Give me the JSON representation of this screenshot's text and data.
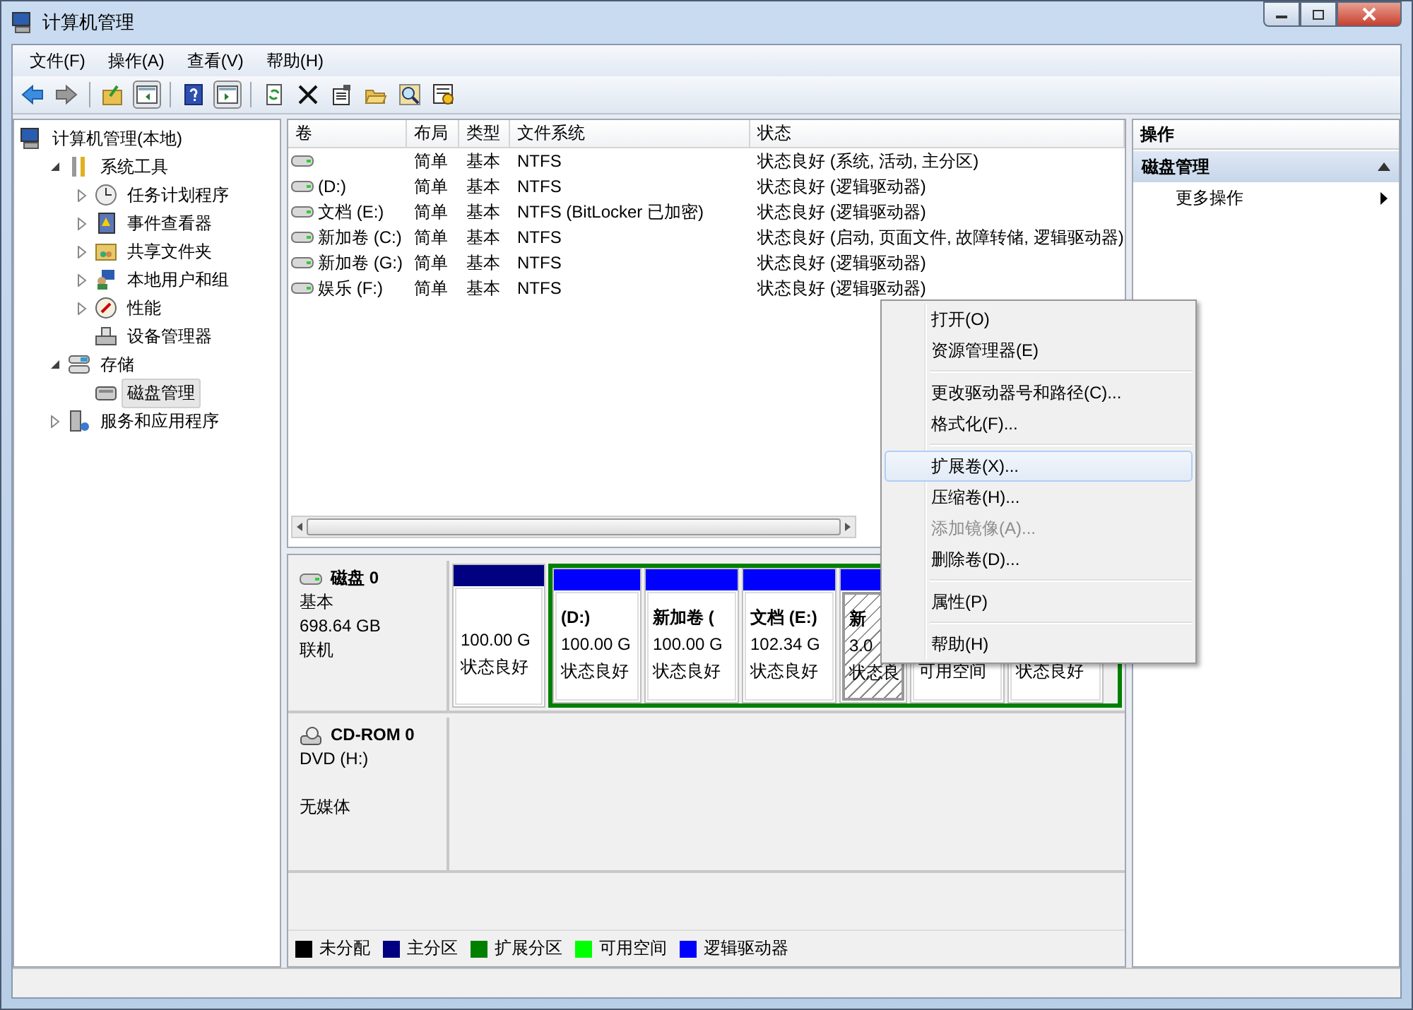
{
  "window": {
    "title": "计算机管理"
  },
  "menu_bar": [
    "文件(F)",
    "操作(A)",
    "查看(V)",
    "帮助(H)"
  ],
  "tree": [
    {
      "label": "计算机管理(本地)",
      "selected": false,
      "children": [
        {
          "label": "系统工具",
          "selected": false,
          "expanded": true,
          "children": [
            {
              "label": "任务计划程序",
              "selected": false,
              "expanded": false
            },
            {
              "label": "事件查看器",
              "selected": false,
              "expanded": false
            },
            {
              "label": "共享文件夹",
              "selected": false,
              "expanded": false
            },
            {
              "label": "本地用户和组",
              "selected": false,
              "expanded": false
            },
            {
              "label": "性能",
              "selected": false,
              "expanded": false
            },
            {
              "label": "设备管理器",
              "selected": false
            }
          ]
        },
        {
          "label": "存储",
          "selected": false,
          "expanded": true,
          "children": [
            {
              "label": "磁盘管理",
              "selected": true
            }
          ]
        },
        {
          "label": "服务和应用程序",
          "selected": false,
          "expanded": false
        }
      ]
    }
  ],
  "volume_table": {
    "columns": [
      "卷",
      "布局",
      "类型",
      "文件系统",
      "状态"
    ],
    "rows": [
      {
        "layout": "简单",
        "type": "基本",
        "file_system": "NTFS",
        "status": "状态良好 (系统, 活动, 主分区)"
      },
      {
        "volume": "(D:)",
        "layout": "简单",
        "type": "基本",
        "file_system": "NTFS",
        "status": "状态良好 (逻辑驱动器)"
      },
      {
        "volume": "文档 (E:)",
        "layout": "简单",
        "type": "基本",
        "file_system": "NTFS (BitLocker 已加密)",
        "status": "状态良好 (逻辑驱动器)"
      },
      {
        "volume": "新加卷 (C:)",
        "layout": "简单",
        "type": "基本",
        "file_system": "NTFS",
        "status": "状态良好 (启动, 页面文件, 故障转储, 逻辑驱动器)"
      },
      {
        "volume": "新加卷 (G:)",
        "layout": "简单",
        "type": "基本",
        "file_system": "NTFS",
        "status": "状态良好 (逻辑驱动器)"
      },
      {
        "volume": "娱乐 (F:)",
        "layout": "简单",
        "type": "基本",
        "file_system": "NTFS",
        "status": "状态良好 (逻辑驱动器)"
      }
    ]
  },
  "disks": [
    {
      "name": "磁盘 0",
      "kind": "disk",
      "lines": [
        "基本",
        "698.64 GB"
      ],
      "status": "联机",
      "partitions": [
        {
          "kind": "primary",
          "selected": false,
          "size": "100.00 G",
          "status": "状态良好"
        },
        {
          "kind": "extended",
          "children": [
            {
              "kind": "logical",
              "selected": false,
              "label": "(D:)",
              "size": "100.00 G",
              "status": "状态良好"
            },
            {
              "kind": "logical",
              "selected": false,
              "label": "新加卷 (",
              "size": "100.00 G",
              "status": "状态良好"
            },
            {
              "kind": "logical",
              "selected": false,
              "label": "文档 (E:)",
              "size": "102.34 G",
              "status": "状态良好"
            },
            {
              "kind": "logical",
              "selected": true,
              "label": "新",
              "size": "3.0",
              "status": "状态良"
            },
            {
              "kind": "free",
              "selected": false,
              "status": "可用空间"
            },
            {
              "kind": "logical",
              "selected": false,
              "status": "状态良好"
            }
          ]
        }
      ]
    },
    {
      "name": "CD-ROM 0",
      "kind": "cdrom",
      "lines": [
        "DVD (H:)"
      ],
      "status": "无媒体"
    }
  ],
  "legend": [
    {
      "label": "未分配",
      "color": "#000000"
    },
    {
      "label": "主分区",
      "color": "#000080"
    },
    {
      "label": "扩展分区",
      "color": "#008000"
    },
    {
      "label": "可用空间",
      "color": "#00ff00"
    },
    {
      "label": "逻辑驱动器",
      "color": "#0000ff"
    }
  ],
  "actions": {
    "title": "操作",
    "section": "磁盘管理",
    "items": [
      "更多操作"
    ]
  },
  "context_menu": [
    {
      "kind": "item",
      "label": "打开(O)",
      "selected": false,
      "disabled": false
    },
    {
      "kind": "item",
      "label": "资源管理器(E)",
      "selected": false,
      "disabled": false
    },
    {
      "kind": "separator"
    },
    {
      "kind": "item",
      "label": "更改驱动器号和路径(C)...",
      "selected": false,
      "disabled": false
    },
    {
      "kind": "item",
      "label": "格式化(F)...",
      "selected": false,
      "disabled": false
    },
    {
      "kind": "separator"
    },
    {
      "kind": "item",
      "label": "扩展卷(X)...",
      "selected": true,
      "disabled": false
    },
    {
      "kind": "item",
      "label": "压缩卷(H)...",
      "selected": false,
      "disabled": false
    },
    {
      "kind": "item",
      "label": "添加镜像(A)...",
      "selected": false,
      "disabled": true
    },
    {
      "kind": "item",
      "label": "删除卷(D)...",
      "selected": false,
      "disabled": false
    },
    {
      "kind": "separator"
    },
    {
      "kind": "item",
      "label": "属性(P)",
      "selected": false,
      "disabled": false
    },
    {
      "kind": "separator"
    },
    {
      "kind": "item",
      "label": "帮助(H)",
      "selected": false,
      "disabled": false
    }
  ]
}
